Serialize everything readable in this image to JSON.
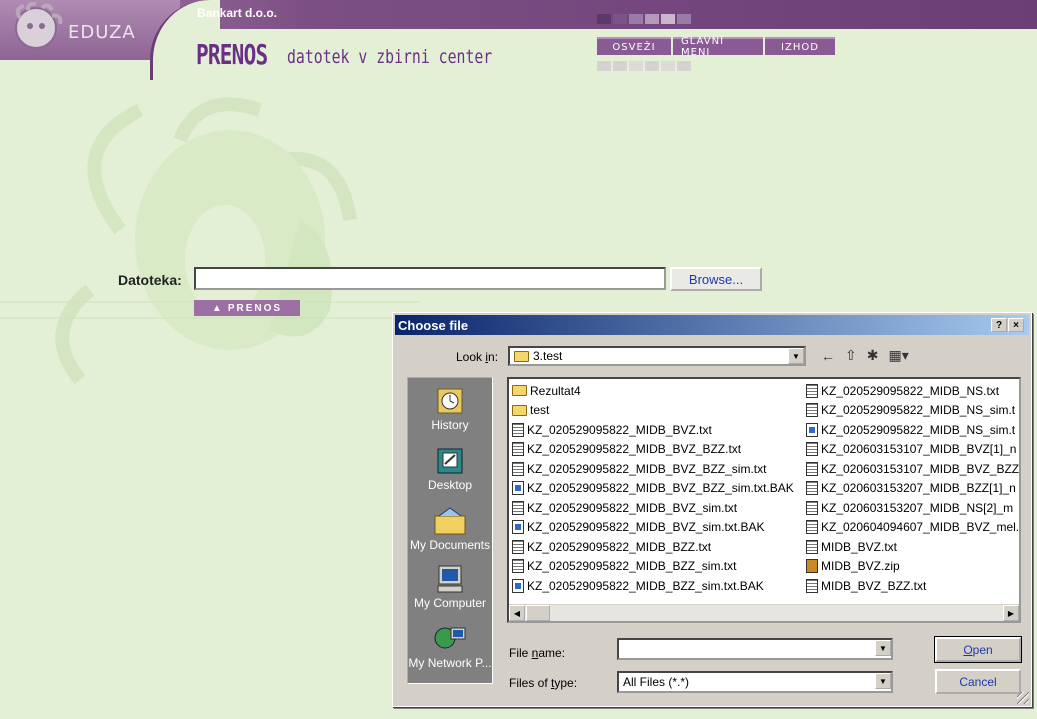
{
  "header": {
    "logo_text": "EDUZA",
    "company": "Bankart d.o.o.",
    "title_main": "PRENOS",
    "title_sub": "datotek v zbirni center",
    "nav": [
      "OSVEŽI",
      "GLAVNI MENI",
      "IZHOD"
    ],
    "colors": {
      "band": "#6a3f76",
      "accent": "#8a5a95",
      "background": "#e4f0d6"
    }
  },
  "form": {
    "file_label": "Datoteka:",
    "file_value": "",
    "browse_label": "Browse...",
    "submit_label": "PRENOS",
    "submit_icon": "triangle-up-icon"
  },
  "dialog": {
    "title": "Choose file",
    "help_label": "?",
    "close_label": "×",
    "look_in_label": "Look in:",
    "look_in_accesskey": "i",
    "look_in_value": "3.test",
    "toolbar_icons": [
      "back-arrow-icon",
      "up-folder-icon",
      "new-folder-icon",
      "view-menu-icon"
    ],
    "places": [
      {
        "label": "History",
        "icon": "history-icon"
      },
      {
        "label": "Desktop",
        "icon": "desktop-icon"
      },
      {
        "label": "My Documents",
        "icon": "my-documents-icon"
      },
      {
        "label": "My Computer",
        "icon": "my-computer-icon"
      },
      {
        "label": "My Network P...",
        "icon": "network-icon"
      }
    ],
    "files_col1": [
      {
        "name": "Rezultat4",
        "type": "folder"
      },
      {
        "name": "test",
        "type": "folder"
      },
      {
        "name": "KZ_020529095822_MIDB_BVZ.txt",
        "type": "txt"
      },
      {
        "name": "KZ_020529095822_MIDB_BVZ_BZZ.txt",
        "type": "txt"
      },
      {
        "name": "KZ_020529095822_MIDB_BVZ_BZZ_sim.txt",
        "type": "txt"
      },
      {
        "name": "KZ_020529095822_MIDB_BVZ_BZZ_sim.txt.BAK",
        "type": "bak"
      },
      {
        "name": "KZ_020529095822_MIDB_BVZ_sim.txt",
        "type": "txt"
      },
      {
        "name": "KZ_020529095822_MIDB_BVZ_sim.txt.BAK",
        "type": "bak"
      },
      {
        "name": "KZ_020529095822_MIDB_BZZ.txt",
        "type": "txt"
      },
      {
        "name": "KZ_020529095822_MIDB_BZZ_sim.txt",
        "type": "txt"
      },
      {
        "name": "KZ_020529095822_MIDB_BZZ_sim.txt.BAK",
        "type": "bak"
      }
    ],
    "files_col2": [
      {
        "name": "KZ_020529095822_MIDB_NS.txt",
        "type": "txt"
      },
      {
        "name": "KZ_020529095822_MIDB_NS_sim.t",
        "type": "txt"
      },
      {
        "name": "KZ_020529095822_MIDB_NS_sim.t",
        "type": "bak"
      },
      {
        "name": "KZ_020603153107_MIDB_BVZ[1]_n",
        "type": "txt"
      },
      {
        "name": "KZ_020603153107_MIDB_BVZ_BZZ",
        "type": "txt"
      },
      {
        "name": "KZ_020603153207_MIDB_BZZ[1]_n",
        "type": "txt"
      },
      {
        "name": "KZ_020603153207_MIDB_NS[2]_m",
        "type": "txt"
      },
      {
        "name": "KZ_020604094607_MIDB_BVZ_mel.",
        "type": "txt"
      },
      {
        "name": "MIDB_BVZ.txt",
        "type": "txt"
      },
      {
        "name": "MIDB_BVZ.zip",
        "type": "zip"
      },
      {
        "name": "MIDB_BVZ_BZZ.txt",
        "type": "txt"
      }
    ],
    "file_name_label": "File name:",
    "file_name_accesskey": "n",
    "file_name_value": "",
    "file_type_label": "Files of type:",
    "file_type_accesskey": "t",
    "file_type_value": "All Files (*.*)",
    "open_label": "Open",
    "open_accesskey": "O",
    "cancel_label": "Cancel"
  }
}
